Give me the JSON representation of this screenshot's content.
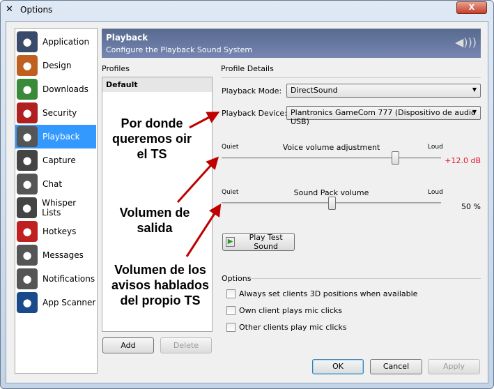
{
  "window": {
    "title": "Options",
    "close_label": "X"
  },
  "sidebar": {
    "items": [
      {
        "label": "Application",
        "icon": "teamspeak-icon",
        "color": "#3a4a6a"
      },
      {
        "label": "Design",
        "icon": "design-tiles-icon",
        "color": "#c06020"
      },
      {
        "label": "Downloads",
        "icon": "downloads-icon",
        "color": "#3a8a3a"
      },
      {
        "label": "Security",
        "icon": "lock-icon",
        "color": "#b02020"
      },
      {
        "label": "Playback",
        "icon": "speaker-icon",
        "color": "#555"
      },
      {
        "label": "Capture",
        "icon": "microphone-icon",
        "color": "#444"
      },
      {
        "label": "Chat",
        "icon": "chat-icon",
        "color": "#555"
      },
      {
        "label": "Whisper Lists",
        "icon": "headset-icon",
        "color": "#444"
      },
      {
        "label": "Hotkeys",
        "icon": "hotkeys-icon",
        "color": "#c02020"
      },
      {
        "label": "Messages",
        "icon": "messages-icon",
        "color": "#555"
      },
      {
        "label": "Notifications",
        "icon": "notifications-icon",
        "color": "#555"
      },
      {
        "label": "App Scanner",
        "icon": "scanner-icon",
        "color": "#1a4a8a"
      }
    ],
    "selected": "Playback"
  },
  "header": {
    "title": "Playback",
    "subtitle": "Configure the Playback Sound System"
  },
  "profiles": {
    "label": "Profiles",
    "items": [
      "Default"
    ],
    "add": "Add",
    "delete": "Delete"
  },
  "details": {
    "label": "Profile Details",
    "mode_label": "Playback Mode:",
    "mode_value": "DirectSound",
    "device_label": "Playback Device:",
    "device_value": "Plantronics GameCom 777 (Dispositivo de audio USB)",
    "voice": {
      "quiet": "Quiet",
      "title": "Voice volume adjustment",
      "loud": "Loud",
      "value": "+12.0 dB",
      "fraction": 0.79
    },
    "soundpack": {
      "quiet": "Quiet",
      "title": "Sound Pack volume",
      "loud": "Loud",
      "value": "50 %",
      "fraction": 0.5
    },
    "play_test": "Play Test Sound"
  },
  "options": {
    "label": "Options",
    "checks": [
      {
        "label": "Always set clients 3D positions when available",
        "checked": false
      },
      {
        "label": "Own client plays mic clicks",
        "checked": false
      },
      {
        "label": "Other clients play mic clicks",
        "checked": false
      }
    ]
  },
  "footer": {
    "ok": "OK",
    "cancel": "Cancel",
    "apply": "Apply"
  },
  "annotations": {
    "a1": [
      "Por donde",
      "queremos oir",
      "el TS"
    ],
    "a2": [
      "Volumen de",
      "salida"
    ],
    "a3": [
      "Volumen de los",
      "avisos hablados",
      "del propio TS"
    ],
    "color": "#c00000"
  }
}
